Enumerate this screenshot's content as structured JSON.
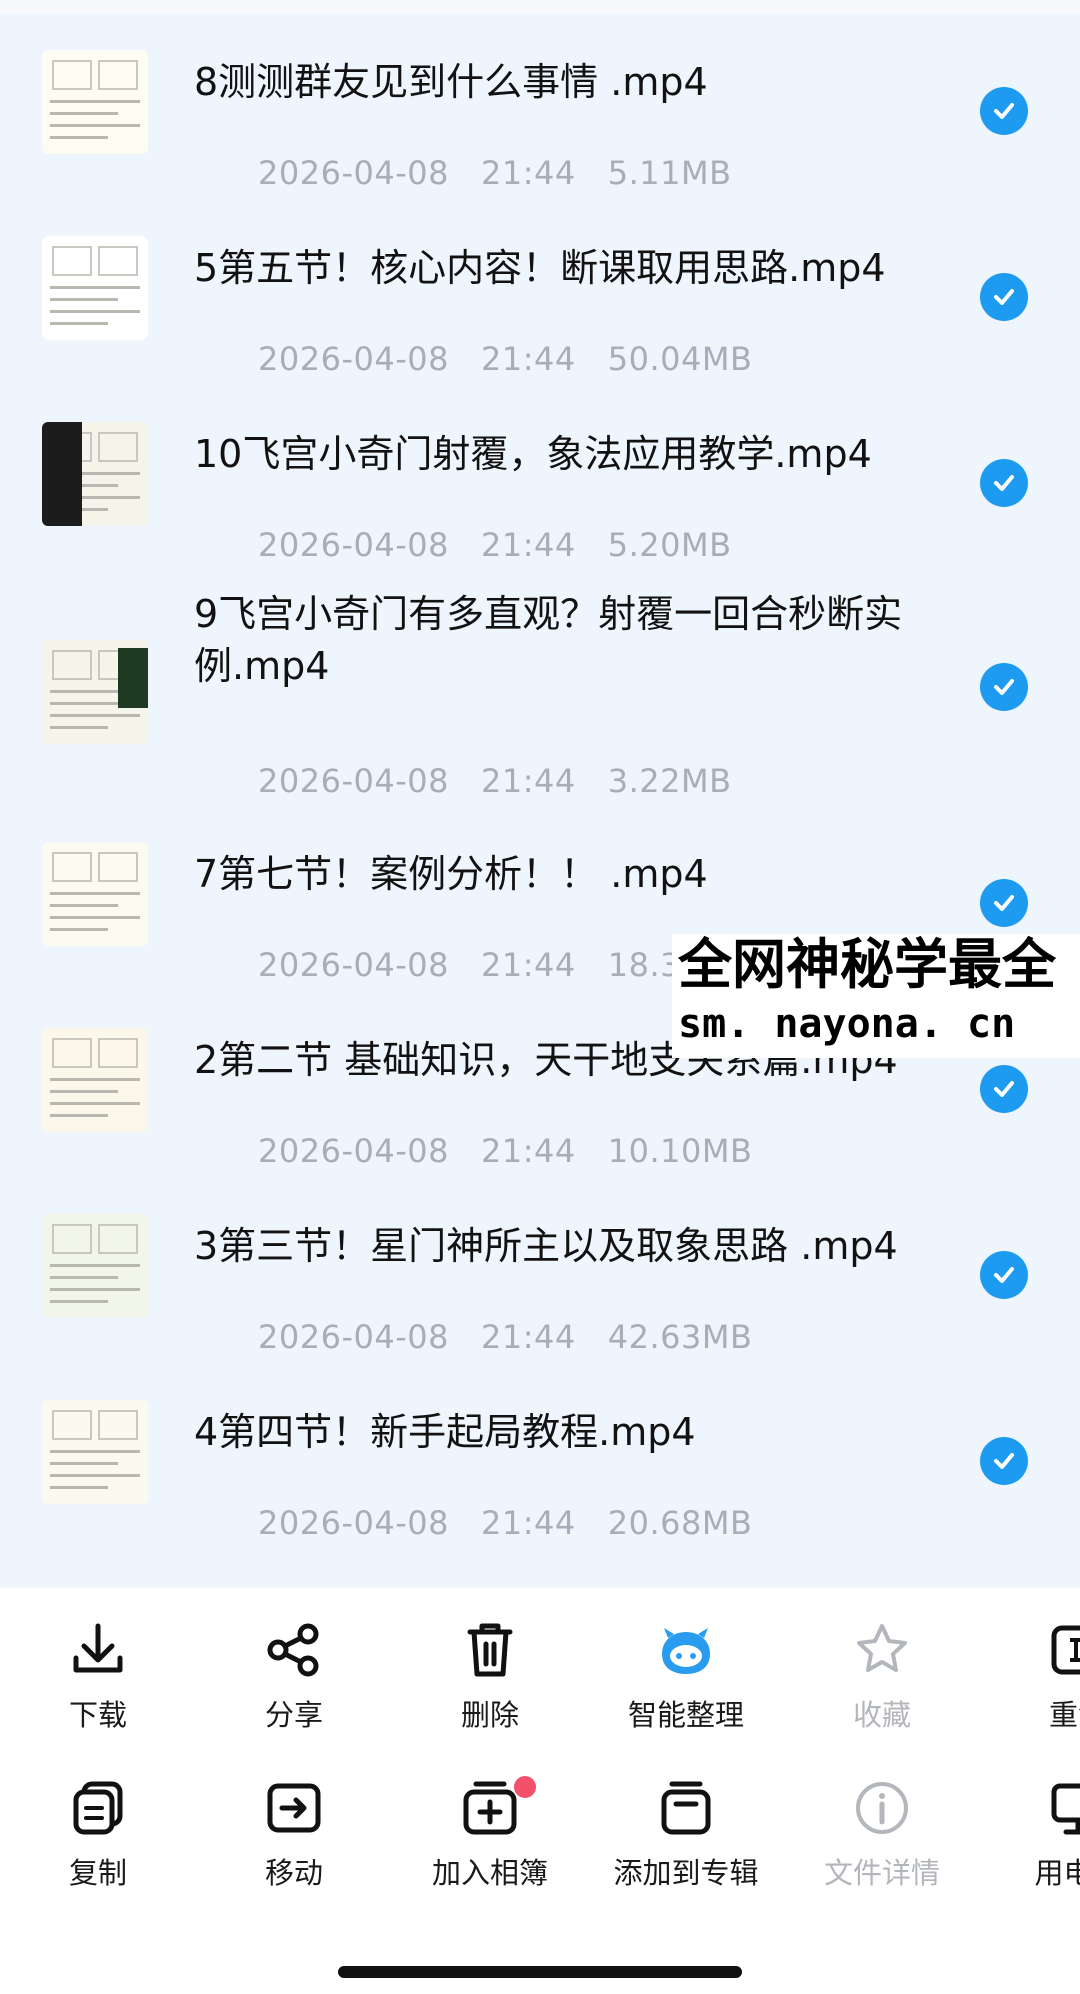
{
  "files": [
    {
      "name": "8测测群友见到什么事情 .mp4",
      "date": "2026-04-08",
      "time": "21:44",
      "size": "5.11MB",
      "selected": true
    },
    {
      "name": "5第五节！核心内容！断课取用思路.mp4",
      "date": "2026-04-08",
      "time": "21:44",
      "size": "50.04MB",
      "selected": true
    },
    {
      "name": "10飞宫小奇门射覆，象法应用教学.mp4",
      "date": "2026-04-08",
      "time": "21:44",
      "size": "5.20MB",
      "selected": true
    },
    {
      "name": "9飞宫小奇门有多直观？射覆一回合秒断实例.mp4",
      "date": "2026-04-08",
      "time": "21:44",
      "size": "3.22MB",
      "selected": true
    },
    {
      "name": "7第七节！案例分析！！ .mp4",
      "date": "2026-04-08",
      "time": "21:44",
      "size": "18.32MB",
      "selected": true
    },
    {
      "name": "2第二节  基础知识，天干地支关系篇.mp4",
      "date": "2026-04-08",
      "time": "21:44",
      "size": "10.10MB",
      "selected": true
    },
    {
      "name": "3第三节！星门神所主以及取象思路 .mp4",
      "date": "2026-04-08",
      "time": "21:44",
      "size": "42.63MB",
      "selected": true
    },
    {
      "name": "4第四节！新手起局教程.mp4",
      "date": "2026-04-08",
      "time": "21:44",
      "size": "20.68MB",
      "selected": true
    }
  ],
  "watermark": {
    "line1": "全网神秘学最全",
    "line2": "sm. nayona. cn"
  },
  "toolbar": {
    "row1": [
      {
        "label": "下载",
        "icon": "download-icon",
        "enabled": true
      },
      {
        "label": "分享",
        "icon": "share-icon",
        "enabled": true
      },
      {
        "label": "删除",
        "icon": "trash-icon",
        "enabled": true
      },
      {
        "label": "智能整理",
        "icon": "smart-organize-icon",
        "enabled": true
      },
      {
        "label": "收藏",
        "icon": "star-icon",
        "enabled": false
      },
      {
        "label": "重命",
        "icon": "rename-icon",
        "enabled": true
      }
    ],
    "row2": [
      {
        "label": "复制",
        "icon": "copy-icon",
        "enabled": true
      },
      {
        "label": "移动",
        "icon": "move-icon",
        "enabled": true
      },
      {
        "label": "加入相簿",
        "icon": "add-to-album-icon",
        "enabled": true
      },
      {
        "label": "添加到专辑",
        "icon": "add-to-collection-icon",
        "enabled": true
      },
      {
        "label": "文件详情",
        "icon": "info-icon",
        "enabled": false
      },
      {
        "label": "用电脑",
        "icon": "computer-icon",
        "enabled": true
      }
    ]
  },
  "colors": {
    "accent": "#1d9bf0",
    "list_bg": "#eef5fc",
    "meta_text": "#a9aeb6",
    "badge": "#f2506b"
  }
}
